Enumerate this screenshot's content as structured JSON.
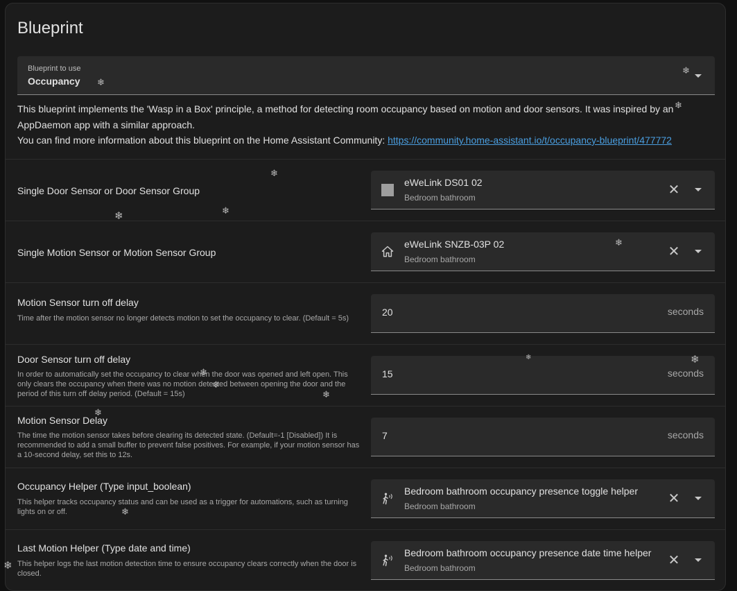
{
  "card": {
    "title": "Blueprint"
  },
  "blueprint_select": {
    "label": "Blueprint to use",
    "value": "Occupancy"
  },
  "description": {
    "line1": "This blueprint implements the 'Wasp in a Box' principle, a method for detecting room occupancy based on motion and door sensors. It was inspired by an AppDaemon app with a similar approach.",
    "line2_prefix": "You can find more information about this blueprint on the Home Assistant Community: ",
    "link": "https://community.home-assistant.io/t/occupancy-blueprint/477772"
  },
  "inputs": [
    {
      "name": "Single Door Sensor or Door Sensor Group",
      "help": "",
      "entity": "eWeLink DS01 02",
      "area": "Bedroom bathroom",
      "icon": "door-sensor-icon"
    },
    {
      "name": "Single Motion Sensor or Motion Sensor Group",
      "help": "",
      "entity": "eWeLink SNZB-03P 02",
      "area": "Bedroom bathroom",
      "icon": "home-icon"
    },
    {
      "name": "Motion Sensor turn off delay",
      "help": "Time after the motion sensor no longer detects motion to set the occupancy to clear. (Default = 5s)",
      "value": "20",
      "unit": "seconds"
    },
    {
      "name": "Door Sensor turn off delay",
      "help": "In order to automatically set the occupancy to clear when the door was opened and left open. This only clears the occupancy when there was no motion detected between opening the door and the period of this turn off delay period. (Default = 15s)",
      "value": "15",
      "unit": "seconds"
    },
    {
      "name": "Motion Sensor Delay",
      "help": "The time the motion sensor takes before clearing its detected state. (Default=-1 [Disabled]) It is recommended to add a small buffer to prevent false positives. For example, if your motion sensor has a 10-second delay, set this to 12s.",
      "value": "7",
      "unit": "seconds"
    },
    {
      "name": "Occupancy Helper (Type input_boolean)",
      "help": "This helper tracks occupancy status and can be used as a trigger for automations, such as turning lights on or off.",
      "entity": "Bedroom bathroom occupancy presence toggle helper",
      "area": "Bedroom bathroom",
      "icon": "motion-sensor-icon"
    },
    {
      "name": "Last Motion Helper (Type date and time)",
      "help": "This helper logs the last motion detection time to ensure occupancy clears correctly when the door is closed.",
      "entity": "Bedroom bathroom occupancy presence date time helper",
      "area": "Bedroom bathroom",
      "icon": "motion-sensor-icon"
    }
  ],
  "icons": {
    "clear": "close-icon",
    "dropdown": "chevron-down-icon"
  },
  "colors": {
    "background": "#111111",
    "card": "#1c1c1c",
    "field": "#2a2a2a",
    "link": "#4a9ee0"
  }
}
